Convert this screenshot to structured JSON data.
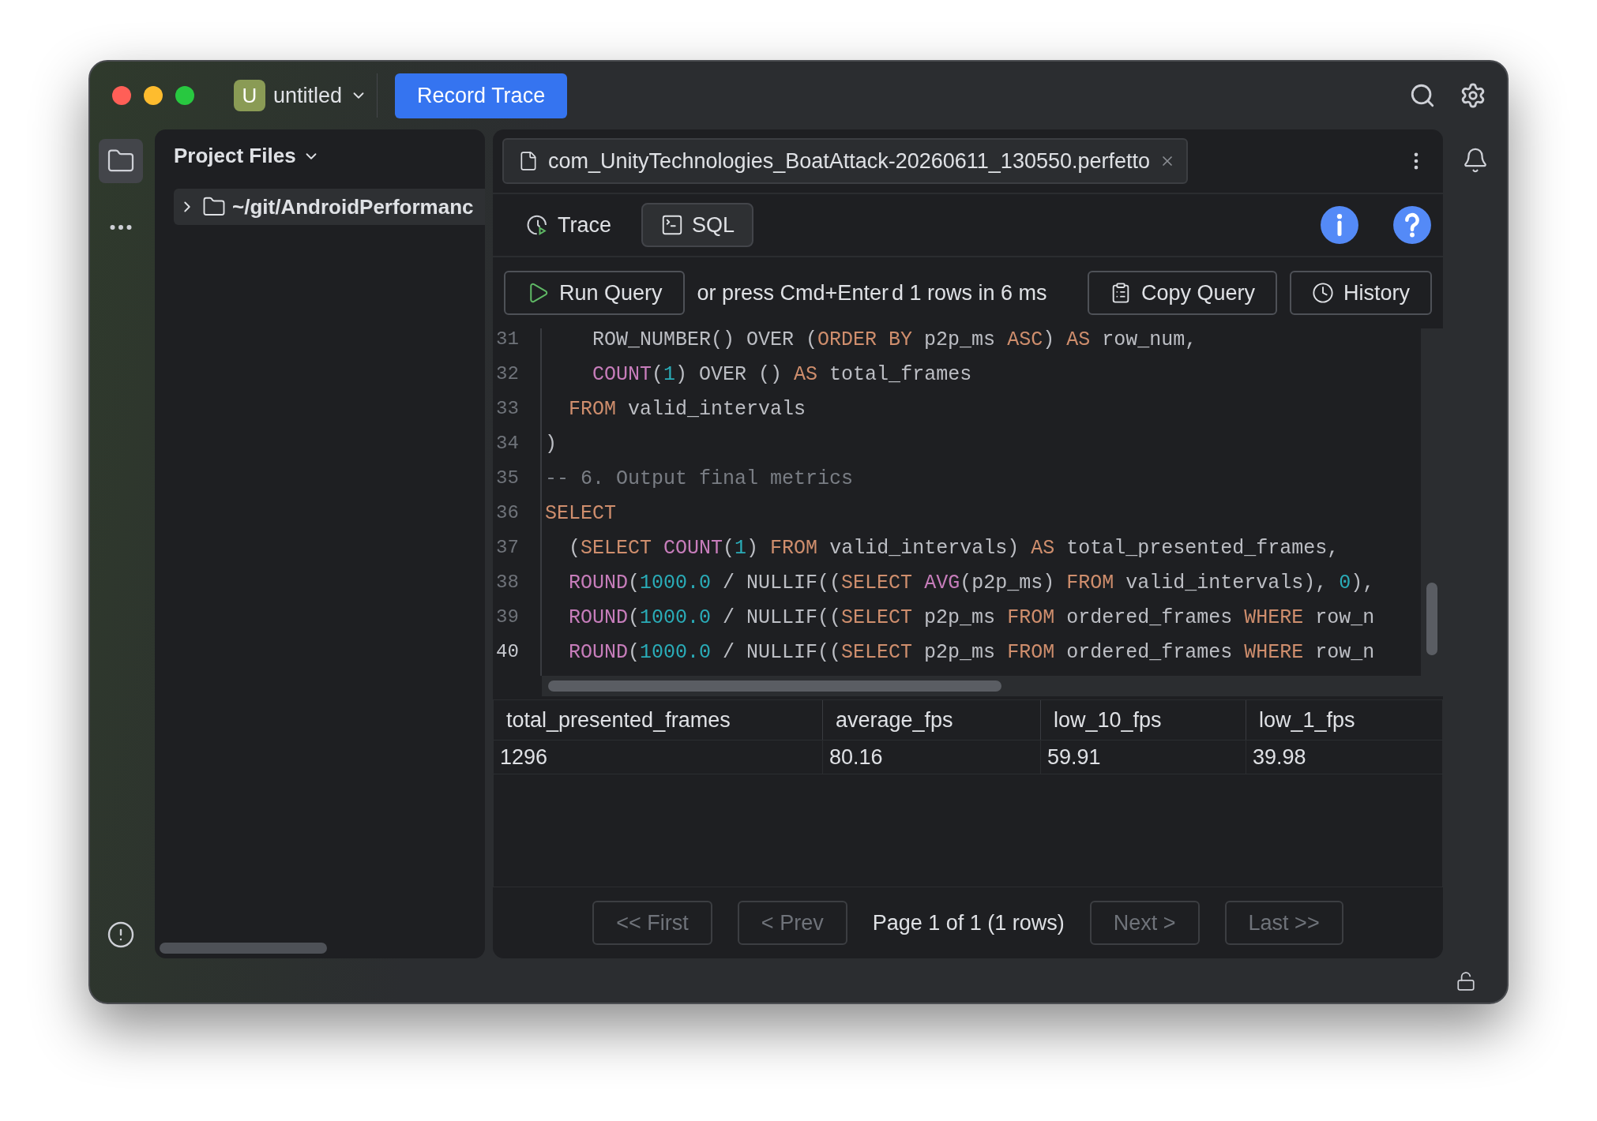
{
  "project": {
    "badge": "U",
    "name": "untitled"
  },
  "record_button": "Record Trace",
  "sidebar": {
    "title": "Project Files",
    "items": [
      {
        "label": "~/git/AndroidPerformanc",
        "expanded": false
      }
    ]
  },
  "editor_tab": {
    "title": "com_UnityTechnologies_BoatAttack-20260611_130550.perfetto"
  },
  "view_tabs": [
    {
      "label": "Trace",
      "kind": "trace",
      "selected": false
    },
    {
      "label": "SQL",
      "kind": "sql",
      "selected": true
    }
  ],
  "toolbar": {
    "run": "Run Query",
    "hint": "or press Cmd+Enter",
    "status": "d 1 rows in 6 ms",
    "copy": "Copy Query",
    "history": "History"
  },
  "code": {
    "lines": [
      {
        "number": "31",
        "current": false,
        "tokens": [
          {
            "text": "    ROW_NUMBER() OVER (",
            "kind": "plain"
          },
          {
            "text": "ORDER BY",
            "kind": "kw"
          },
          {
            "text": " p2p_ms ",
            "kind": "plain"
          },
          {
            "text": "ASC",
            "kind": "kw"
          },
          {
            "text": ") ",
            "kind": "plain"
          },
          {
            "text": "AS",
            "kind": "kw"
          },
          {
            "text": " row_num,",
            "kind": "plain"
          }
        ]
      },
      {
        "number": "32",
        "current": false,
        "tokens": [
          {
            "text": "    COUNT",
            "kind": "fn"
          },
          {
            "text": "(",
            "kind": "plain"
          },
          {
            "text": "1",
            "kind": "num"
          },
          {
            "text": ") OVER () ",
            "kind": "plain"
          },
          {
            "text": "AS",
            "kind": "kw"
          },
          {
            "text": " total_frames",
            "kind": "plain"
          }
        ]
      },
      {
        "number": "33",
        "current": false,
        "tokens": [
          {
            "text": "  FROM",
            "kind": "kw"
          },
          {
            "text": " valid_intervals",
            "kind": "plain"
          }
        ]
      },
      {
        "number": "34",
        "current": false,
        "tokens": [
          {
            "text": ")",
            "kind": "plain"
          }
        ]
      },
      {
        "number": "35",
        "current": false,
        "tokens": [
          {
            "text": "-- 6. Output final metrics",
            "kind": "comment"
          }
        ]
      },
      {
        "number": "36",
        "current": false,
        "tokens": [
          {
            "text": "SELECT",
            "kind": "kw"
          }
        ]
      },
      {
        "number": "37",
        "current": false,
        "tokens": [
          {
            "text": "  (",
            "kind": "plain"
          },
          {
            "text": "SELECT ",
            "kind": "kw"
          },
          {
            "text": "COUNT",
            "kind": "fn"
          },
          {
            "text": "(",
            "kind": "plain"
          },
          {
            "text": "1",
            "kind": "num"
          },
          {
            "text": ") ",
            "kind": "plain"
          },
          {
            "text": "FROM",
            "kind": "kw"
          },
          {
            "text": " valid_intervals) ",
            "kind": "plain"
          },
          {
            "text": "AS",
            "kind": "kw"
          },
          {
            "text": " total_presented_frames,",
            "kind": "plain"
          }
        ]
      },
      {
        "number": "38",
        "current": false,
        "tokens": [
          {
            "text": "  ROUND",
            "kind": "fn"
          },
          {
            "text": "(",
            "kind": "plain"
          },
          {
            "text": "1000.0",
            "kind": "num"
          },
          {
            "text": " / NULLIF((",
            "kind": "plain"
          },
          {
            "text": "SELECT ",
            "kind": "kw"
          },
          {
            "text": "AVG",
            "kind": "fn"
          },
          {
            "text": "(p2p_ms) ",
            "kind": "plain"
          },
          {
            "text": "FROM",
            "kind": "kw"
          },
          {
            "text": " valid_intervals), ",
            "kind": "plain"
          },
          {
            "text": "0",
            "kind": "num"
          },
          {
            "text": "),",
            "kind": "plain"
          }
        ]
      },
      {
        "number": "39",
        "current": false,
        "tokens": [
          {
            "text": "  ROUND",
            "kind": "fn"
          },
          {
            "text": "(",
            "kind": "plain"
          },
          {
            "text": "1000.0",
            "kind": "num"
          },
          {
            "text": " / NULLIF((",
            "kind": "plain"
          },
          {
            "text": "SELECT",
            "kind": "kw"
          },
          {
            "text": " p2p_ms ",
            "kind": "plain"
          },
          {
            "text": "FROM",
            "kind": "kw"
          },
          {
            "text": " ordered_frames ",
            "kind": "plain"
          },
          {
            "text": "WHERE",
            "kind": "kw"
          },
          {
            "text": " row_n",
            "kind": "plain"
          }
        ]
      },
      {
        "number": "40",
        "current": true,
        "tokens": [
          {
            "text": "  ROUND",
            "kind": "fn"
          },
          {
            "text": "(",
            "kind": "plain"
          },
          {
            "text": "1000.0",
            "kind": "num"
          },
          {
            "text": " / NULLIF((",
            "kind": "plain"
          },
          {
            "text": "SELECT",
            "kind": "kw"
          },
          {
            "text": " p2p_ms ",
            "kind": "plain"
          },
          {
            "text": "FROM",
            "kind": "kw"
          },
          {
            "text": " ordered_frames ",
            "kind": "plain"
          },
          {
            "text": "WHERE",
            "kind": "kw"
          },
          {
            "text": " row_n",
            "kind": "plain"
          }
        ]
      }
    ]
  },
  "results": {
    "columns": [
      "total_presented_frames",
      "average_fps",
      "low_10_fps",
      "low_1_fps"
    ],
    "rows": [
      [
        "1296",
        "80.16",
        "59.91",
        "39.98"
      ]
    ]
  },
  "pagination": {
    "buttons": [
      {
        "label": "<< First",
        "disabled": true
      },
      {
        "label": "< Prev",
        "disabled": true
      },
      {
        "label": "Next >",
        "disabled": true
      },
      {
        "label": "Last >>",
        "disabled": true
      }
    ],
    "page_label": "Page 1 of 1 (1 rows)"
  }
}
